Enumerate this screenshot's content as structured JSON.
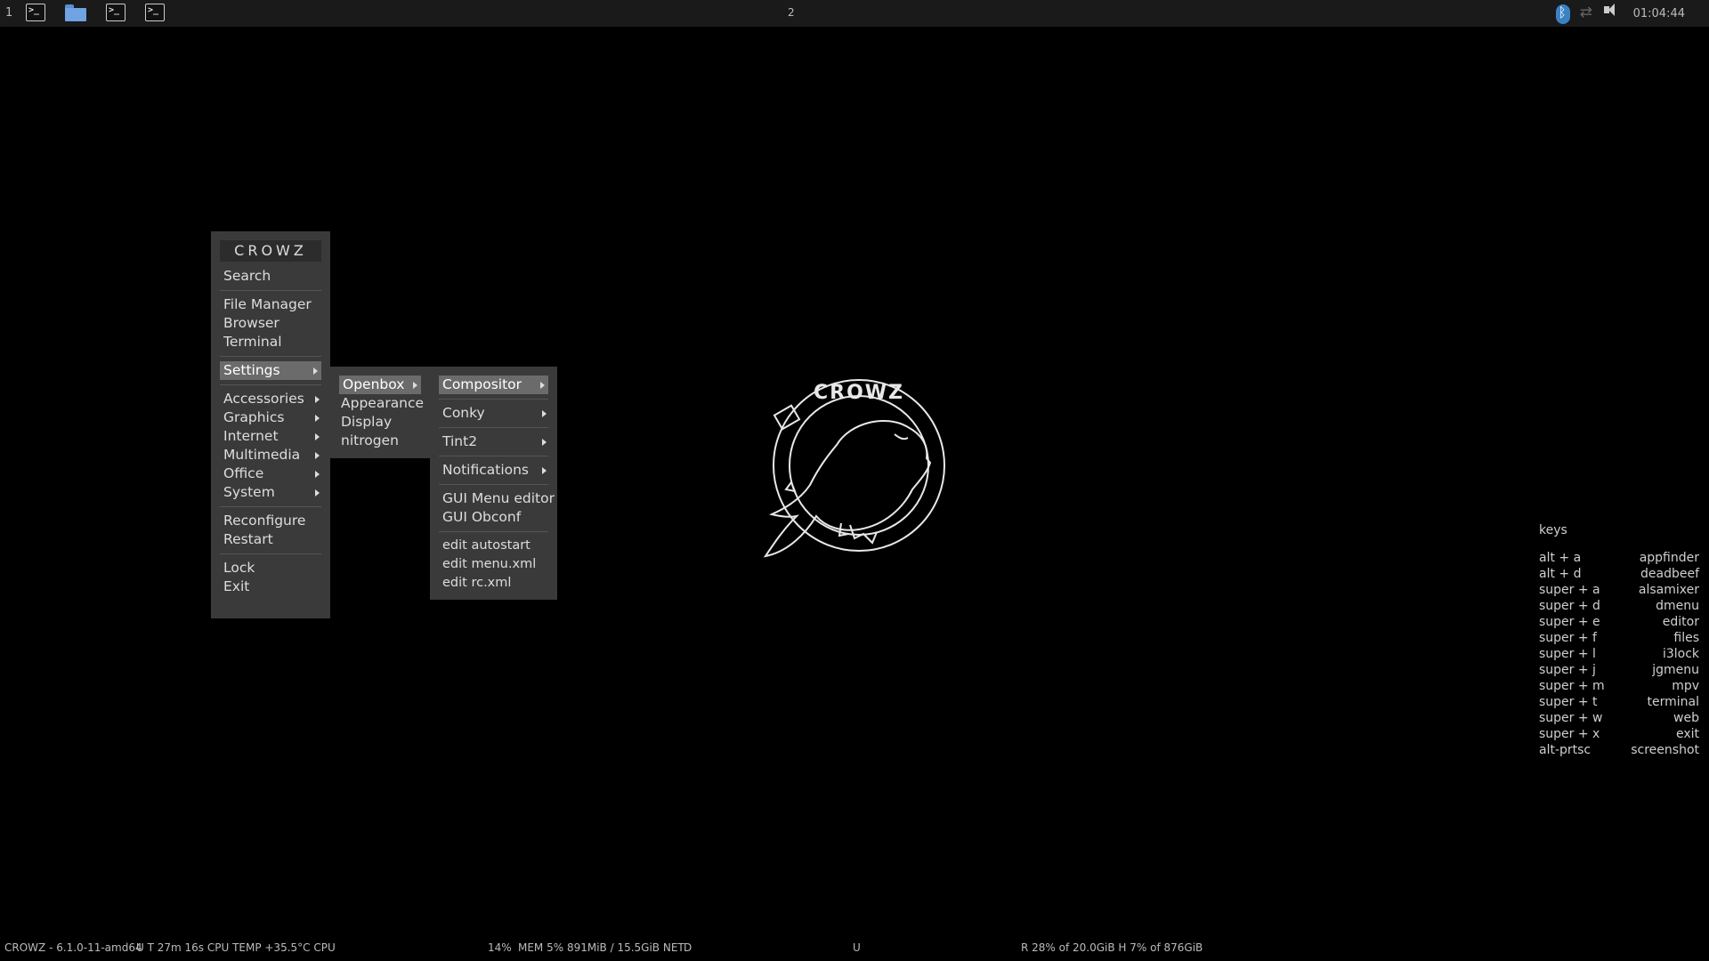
{
  "top_panel": {
    "workspace_left": "1",
    "workspace_center": "2",
    "clock": "01:04:44",
    "icons": [
      "terminal-icon",
      "folder-icon",
      "terminal-icon",
      "terminal-icon",
      "bluetooth-icon",
      "network-icon",
      "volume-icon"
    ]
  },
  "main_menu": {
    "title": "CROWZ",
    "search": "Search",
    "file_manager": "File Manager",
    "browser": "Browser",
    "terminal": "Terminal",
    "settings": "Settings",
    "accessories": "Accessories",
    "graphics": "Graphics",
    "internet": "Internet",
    "multimedia": "Multimedia",
    "office": "Office",
    "system": "System",
    "reconfigure": "Reconfigure",
    "restart": "Restart",
    "lock": "Lock",
    "exit": "Exit"
  },
  "settings_menu": {
    "openbox": "Openbox",
    "appearance": "Appearance",
    "display": "Display",
    "nitrogen": "nitrogen"
  },
  "openbox_menu": {
    "compositor": "Compositor",
    "conky": "Conky",
    "tint2": "Tint2",
    "notifications": "Notifications",
    "gui_menu_editor": "GUI Menu editor",
    "gui_obconf": "GUI Obconf",
    "edit_autostart": "edit autostart",
    "edit_menu_xml": "edit menu.xml",
    "edit_rc_xml": "edit rc.xml"
  },
  "logo": {
    "text": "CROWZ"
  },
  "keys": {
    "title": "keys",
    "rows": [
      {
        "key": "alt + a",
        "action": "appfinder"
      },
      {
        "key": "alt + d",
        "action": "deadbeef"
      },
      {
        "key": "super + a",
        "action": "alsamixer"
      },
      {
        "key": "super + d",
        "action": "dmenu"
      },
      {
        "key": "super + e",
        "action": "editor"
      },
      {
        "key": "super + f",
        "action": "files"
      },
      {
        "key": "super + l",
        "action": "i3lock"
      },
      {
        "key": "super + j",
        "action": "jgmenu"
      },
      {
        "key": "super + m",
        "action": "mpv"
      },
      {
        "key": "super + t",
        "action": "terminal"
      },
      {
        "key": "super + w",
        "action": "web"
      },
      {
        "key": "super + x",
        "action": "exit"
      },
      {
        "key": "alt-prtsc",
        "action": "screenshot"
      }
    ]
  },
  "status_bar": {
    "system": "CROWZ - 6.1.0-11-amd64",
    "uptime": "U T 27m 16s CPU TEMP  +35.5°C CPU",
    "cpu": "14%",
    "mem": "MEM 5% 891MiB / 15.5GiB  NET",
    "net_down": "D",
    "net_up": "U",
    "disk": "R 28% of 20.0GiB H   7% of 876GiB"
  }
}
